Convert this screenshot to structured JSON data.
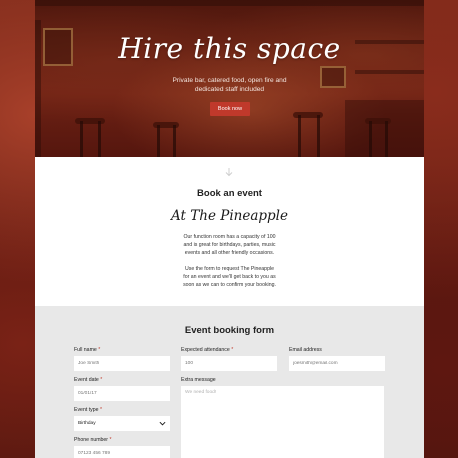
{
  "hero": {
    "title": "Hire this space",
    "subtitle_line1": "Private bar, catered food, open fire and",
    "subtitle_line2": "dedicated staff included",
    "book_button": "Book now"
  },
  "book_section": {
    "heading": "Book an event",
    "venue": "At The Pineapple",
    "paragraph1": [
      "Our function room has a capacity of 100",
      "and is great for birthdays, parties, music",
      "events and all other friendly occasions."
    ],
    "paragraph2": [
      "Use the form to request The Pineapple",
      "for an event and we'll get back to you as",
      "soon as we can to confirm your booking."
    ]
  },
  "form": {
    "title": "Event booking form",
    "full_name": {
      "label": "Full name",
      "placeholder": "Joe Smith"
    },
    "expected_attendance": {
      "label": "Expected attendance",
      "placeholder": "100"
    },
    "email": {
      "label": "Email address",
      "placeholder": "joesmith@email.com"
    },
    "event_date": {
      "label": "Event date",
      "placeholder": "01/01/17"
    },
    "extra_message": {
      "label": "Extra message",
      "placeholder": "We need food!"
    },
    "event_type": {
      "label": "Event type",
      "value": "Birthday"
    },
    "phone": {
      "label": "Phone number",
      "placeholder": "07123 456 789"
    },
    "required_marker": "*"
  },
  "colors": {
    "accent": "#c0392b",
    "form_bg": "#e8e8e8"
  }
}
